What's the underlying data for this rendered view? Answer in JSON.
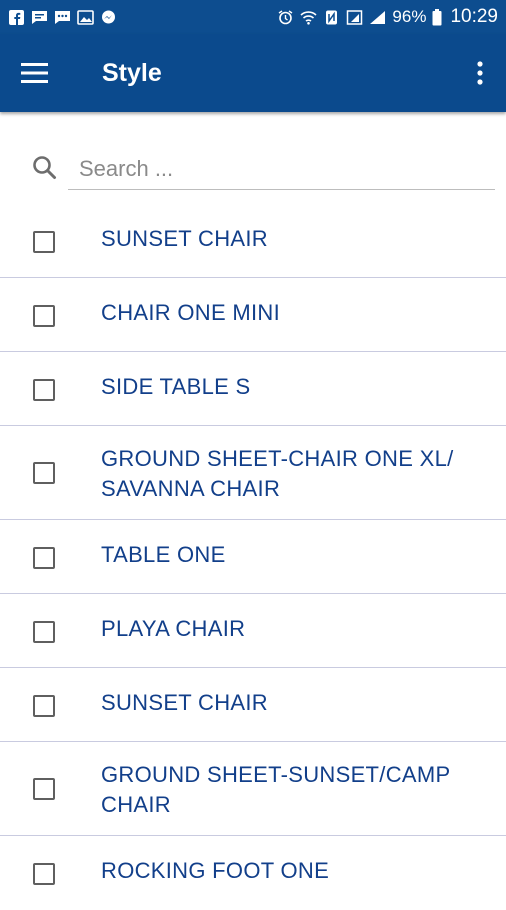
{
  "status_bar": {
    "left_icons": [
      "facebook-icon",
      "message-icon",
      "chat-icon",
      "image-icon",
      "messenger-icon"
    ],
    "right_icons": [
      "alarm-icon",
      "wifi-icon",
      "nfc-icon",
      "sim-icon",
      "signal-icon"
    ],
    "battery_percent": "96%",
    "time": "10:29"
  },
  "app_bar": {
    "title": "Style",
    "menu_icon": "hamburger-menu-icon",
    "more_icon": "more-vertical-icon",
    "background_color": "#0b4a8d"
  },
  "search": {
    "placeholder": "Search ...",
    "value": ""
  },
  "items": [
    {
      "label": "SUNSET CHAIR",
      "checked": false
    },
    {
      "label": "CHAIR ONE MINI",
      "checked": false
    },
    {
      "label": "SIDE TABLE S",
      "checked": false
    },
    {
      "label": "GROUND SHEET-CHAIR ONE XL/ SAVANNA CHAIR",
      "checked": false
    },
    {
      "label": "TABLE ONE",
      "checked": false
    },
    {
      "label": "PLAYA CHAIR",
      "checked": false
    },
    {
      "label": "SUNSET CHAIR",
      "checked": false
    },
    {
      "label": "GROUND SHEET-SUNSET/CAMP CHAIR",
      "checked": false
    },
    {
      "label": "ROCKING FOOT ONE",
      "checked": false
    }
  ],
  "colors": {
    "accent": "#0b4a8d",
    "item_text": "#123f8a",
    "divider": "#c9cbe0"
  }
}
